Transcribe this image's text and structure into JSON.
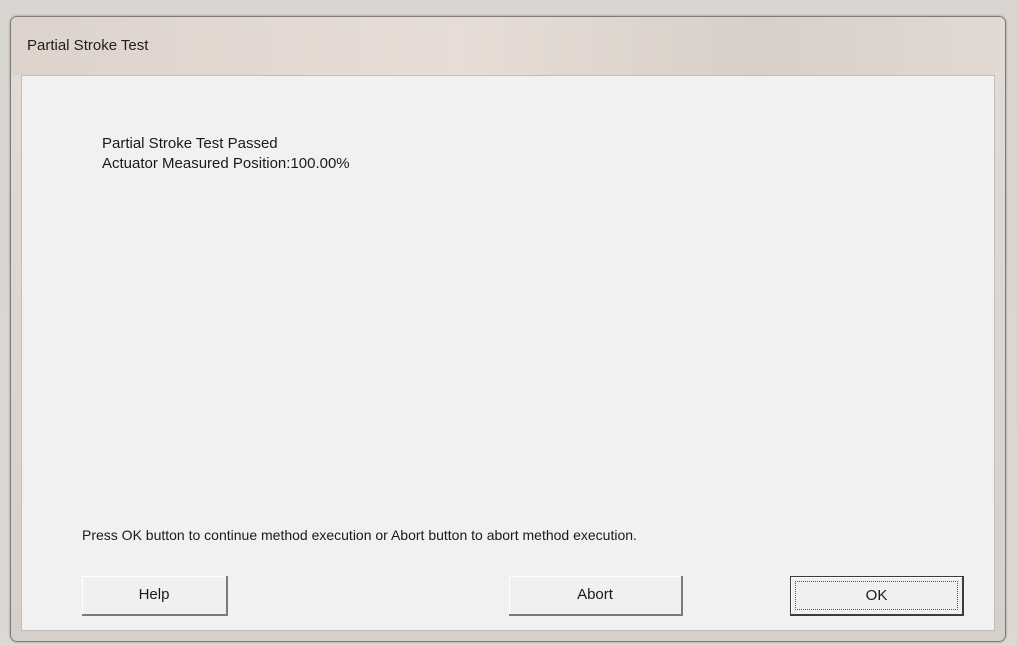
{
  "dialog": {
    "title": "Partial Stroke Test"
  },
  "content": {
    "status_line": "Partial Stroke Test Passed",
    "position_line": "Actuator Measured Position:100.00%",
    "instruction": "Press OK button to continue method execution or Abort button to abort method execution."
  },
  "buttons": {
    "help_label": "Help",
    "abort_label": "Abort",
    "ok_label": "OK"
  }
}
